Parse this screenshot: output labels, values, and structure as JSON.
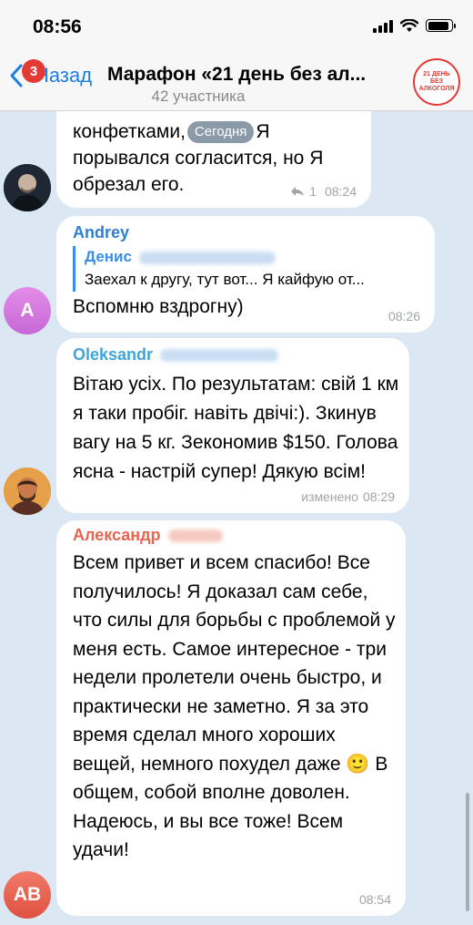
{
  "status_bar": {
    "time": "08:56"
  },
  "header": {
    "back_label": "Назад",
    "unread_count": "3",
    "title": "Марафон «21 день без ал...",
    "subtitle": "42 участника",
    "avatar_line1": "21 ДЕНЬ",
    "avatar_line2": "БЕЗ АЛКОГОЛЯ"
  },
  "date_pill": "Сегодня",
  "messages": [
    {
      "lines": [
        "конфетками,",
        "Я",
        "порывался согласится, но Я",
        "обрезал его."
      ],
      "reply_count": "1",
      "time": "08:24"
    },
    {
      "sender": "Andrey",
      "avatar_letter": "A",
      "reply_to_name": "Денис",
      "reply_to_text": "Заехал к другу, тут вот... Я кайфую от...",
      "text": "Вспомню вздрогну)",
      "time": "08:26"
    },
    {
      "sender": "Oleksandr",
      "text": "Вітаю усіх. По результатам: свій 1 км я таки пробіг. навіть двічі:). Зкинув вагу на 5 кг. Зекономив $150. Голова ясна - настрій супер! Дякую всім!",
      "edited_label": "изменено",
      "time": "08:29"
    },
    {
      "sender": "Александр",
      "avatar_letters": "AB",
      "text_part1": "Всем привет и всем спасибо! Все получилось! Я доказал сам себе,  что силы для борьбы с проблемой у меня есть. Самое интересное - три недели пролетели очень быстро, и практически не заметно. Я за это время сделал много хороших вещей, немного похудел даже",
      "emoji": "🙂",
      "text_part2": "В общем, собой вполне доволен. Надеюсь,  и вы все тоже! Всем удачи!",
      "time": "08:54"
    }
  ],
  "colors": {
    "link_blue": "#1a7ee6",
    "andrey_name": "#2f7fd1",
    "oleksandr_name": "#3fa5d9",
    "aleksandr_name": "#e8654f",
    "badge_red": "#e53935",
    "chat_bg": "#dbe8f4"
  }
}
